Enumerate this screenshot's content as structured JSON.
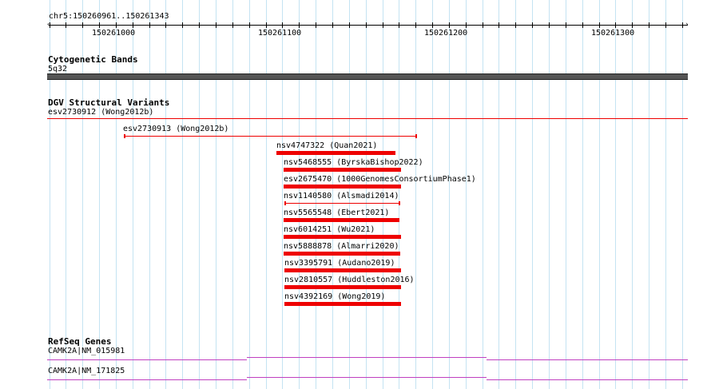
{
  "ruler": {
    "region": "chr5:150260961..150261343",
    "ticks": [
      "150261000",
      "150261100",
      "150261200",
      "150261300"
    ]
  },
  "cytoband": {
    "title": "Cytogenetic Bands",
    "band": "5q32",
    "color": "#555555"
  },
  "dgv": {
    "title": "DGV Structural Variants",
    "top_label": "esv2730912 (Wong2012b)",
    "color": "#ee0000",
    "variants": [
      {
        "label": "esv2730913 (Wong2012b)",
        "style": "thin"
      },
      {
        "label": "nsv4747322 (Quan2021)",
        "style": "thick"
      },
      {
        "label": "nsv5468555 (ByrskaBishop2022)",
        "style": "thick"
      },
      {
        "label": "esv2675470 (1000GenomesConsortiumPhase1)",
        "style": "thick"
      },
      {
        "label": "nsv1140580 (Alsmadi2014)",
        "style": "thin"
      },
      {
        "label": "nsv5565548 (Ebert2021)",
        "style": "thick"
      },
      {
        "label": "nsv6014251 (Wu2021)",
        "style": "thick"
      },
      {
        "label": "nsv5888878 (Almarri2020)",
        "style": "thick"
      },
      {
        "label": "nsv3395791 (Audano2019)",
        "style": "thick"
      },
      {
        "label": "nsv2810557 (Huddleston2016)",
        "style": "thick"
      },
      {
        "label": "nsv4392169 (Wong2019)",
        "style": "thick"
      }
    ]
  },
  "refseq": {
    "title": "RefSeq Genes",
    "color": "#c040c0",
    "genes": [
      {
        "label": "CAMK2A|NM_015981"
      },
      {
        "label": "CAMK2A|NM_171825"
      }
    ]
  }
}
